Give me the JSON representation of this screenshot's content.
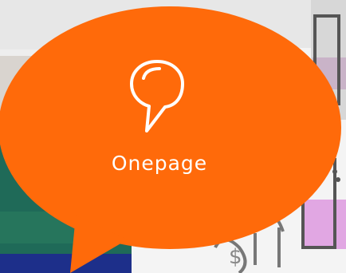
{
  "card": {
    "label": "Onepage",
    "accent_color": "#ff6a0a",
    "icon": "speech-bubble-icon"
  }
}
